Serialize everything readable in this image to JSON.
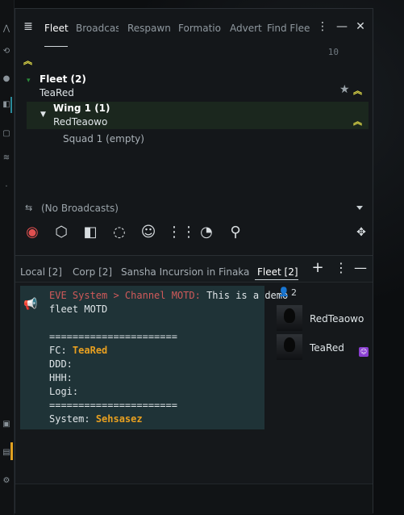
{
  "fleet_window": {
    "tabs": [
      "Fleet",
      "Broadcas",
      "Respawn",
      "Formatio",
      "Advert",
      "Find Flee"
    ],
    "counter": "10",
    "fleet": {
      "title": "Fleet (2)",
      "commander": "TeaRed",
      "wing_title": "Wing 1 (1)",
      "wing_commander": "RedTeaowo",
      "squad": "Squad 1 (empty)"
    },
    "broadcasts_label": "(No Broadcasts)",
    "broadcast_buttons": [
      "eye-icon",
      "cube-plus-icon",
      "shield-plus-icon",
      "target-plus-icon",
      "smiley-icon",
      "grid-icon",
      "broadcast-person-icon",
      "location-pin-icon"
    ]
  },
  "chat": {
    "tabs": [
      "Local [2]",
      "Corp [2]",
      "Sansha Incursion in Finaka",
      "Fleet [2]"
    ],
    "motd": {
      "prefix": "EVE System > Channel MOTD:",
      "text_1": "This is a demo",
      "text_2": "fleet MOTD",
      "separator": "======================",
      "fc_label": "FC:",
      "fc_value": "TeaRed",
      "ddd_label": "DDD:",
      "hhh_label": "HHH:",
      "logi_label": "Logi:",
      "system_label": "System:",
      "system_value": "Sehsasez"
    },
    "member_count": "2",
    "members": [
      "RedTeaowo",
      "TeaRed"
    ]
  },
  "colors": {
    "accent_yellow": "#e6e04a",
    "orange": "#e8a020",
    "system_red": "#d05a5a",
    "motd_bg": "#1f3337"
  }
}
